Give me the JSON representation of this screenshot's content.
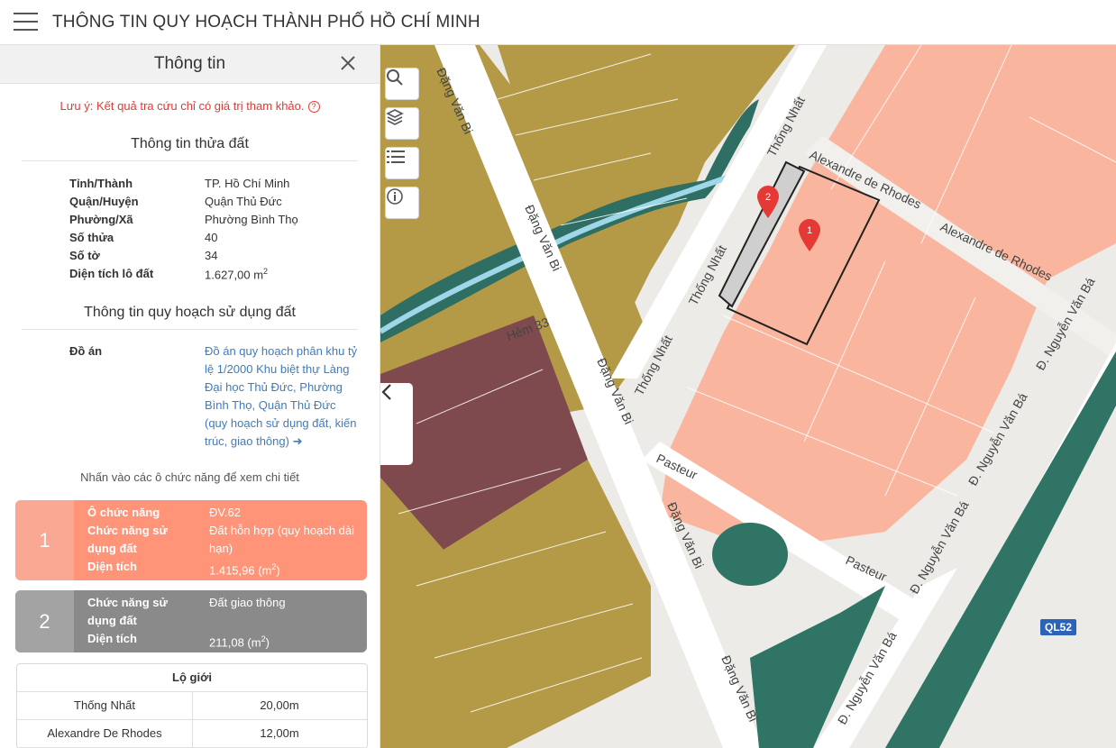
{
  "header": {
    "title": "THÔNG TIN QUY HOẠCH THÀNH PHỐ HỒ CHÍ MINH"
  },
  "panel": {
    "title": "Thông tin",
    "note": "Lưu ý: Kết quả tra cứu chỉ có giá trị tham khảo.",
    "parcel_section_title": "Thông tin thửa đất",
    "parcel": [
      {
        "key": "Tỉnh/Thành",
        "value": "TP. Hồ Chí Minh"
      },
      {
        "key": "Quận/Huyện",
        "value": "Quận Thủ Đức"
      },
      {
        "key": "Phường/Xã",
        "value": "Phường Bình Thọ"
      },
      {
        "key": "Số thửa",
        "value": "40"
      },
      {
        "key": "Số tờ",
        "value": "34"
      }
    ],
    "area_key": "Diện tích lô đất",
    "area_value": "1.627,00 m",
    "area_sup": "2",
    "plan_section_title": "Thông tin quy hoạch sử dụng đất",
    "plan_key": "Đồ án",
    "plan_value": "Đồ án quy hoạch phân khu tỷ lệ 1/2000 Khu biệt thự Làng Đại học Thủ Đức, Phường Bình Thọ, Quận Thủ Đức (quy hoạch sử dụng đất, kiến trúc, giao thông)",
    "hint": "Nhấn vào các ô chức năng để xem chi tiết",
    "functions": [
      {
        "number": "1",
        "o_key": "Ô chức năng",
        "o_value": "ĐV.62",
        "use_key": "Chức năng sử dụng đất",
        "use_value": "Đất hỗn hợp (quy hoạch dài hạn)",
        "area_key": "Diện tích",
        "area_value": "1.415,96 (m",
        "area_sup": "2",
        "area_close": ")"
      },
      {
        "number": "2",
        "use_key": "Chức năng sử dụng đất",
        "use_value": "Đất giao thông",
        "area_key": "Diện tích",
        "area_value": "211,08 (m",
        "area_sup": "2",
        "area_close": ")"
      }
    ],
    "lo_gioi": {
      "title": "Lộ giới",
      "rows": [
        {
          "road": "Thống Nhất",
          "width": "20,00m"
        },
        {
          "road": "Alexandre De Rhodes",
          "width": "12,00m"
        }
      ]
    }
  },
  "map": {
    "road_labels": {
      "dang_van_bi": "Đặng Văn Bi",
      "thong_nhat": "Thống Nhất",
      "alexandre": "Alexandre de Rhodes",
      "pasteur": "Pasteur",
      "nguyen_van_ba": "Đ. Nguyễn Văn Bá",
      "hem": "Hẻm 33"
    },
    "marker_1": "1",
    "marker_2": "2",
    "highway_badge": "QL52",
    "colors": {
      "mixed_use": "#f9b59e",
      "residential": "#b49a46",
      "water": "#2e6e63",
      "green": "#2f7464",
      "public": "#7e4a4d",
      "road": "#e6e4df"
    }
  }
}
